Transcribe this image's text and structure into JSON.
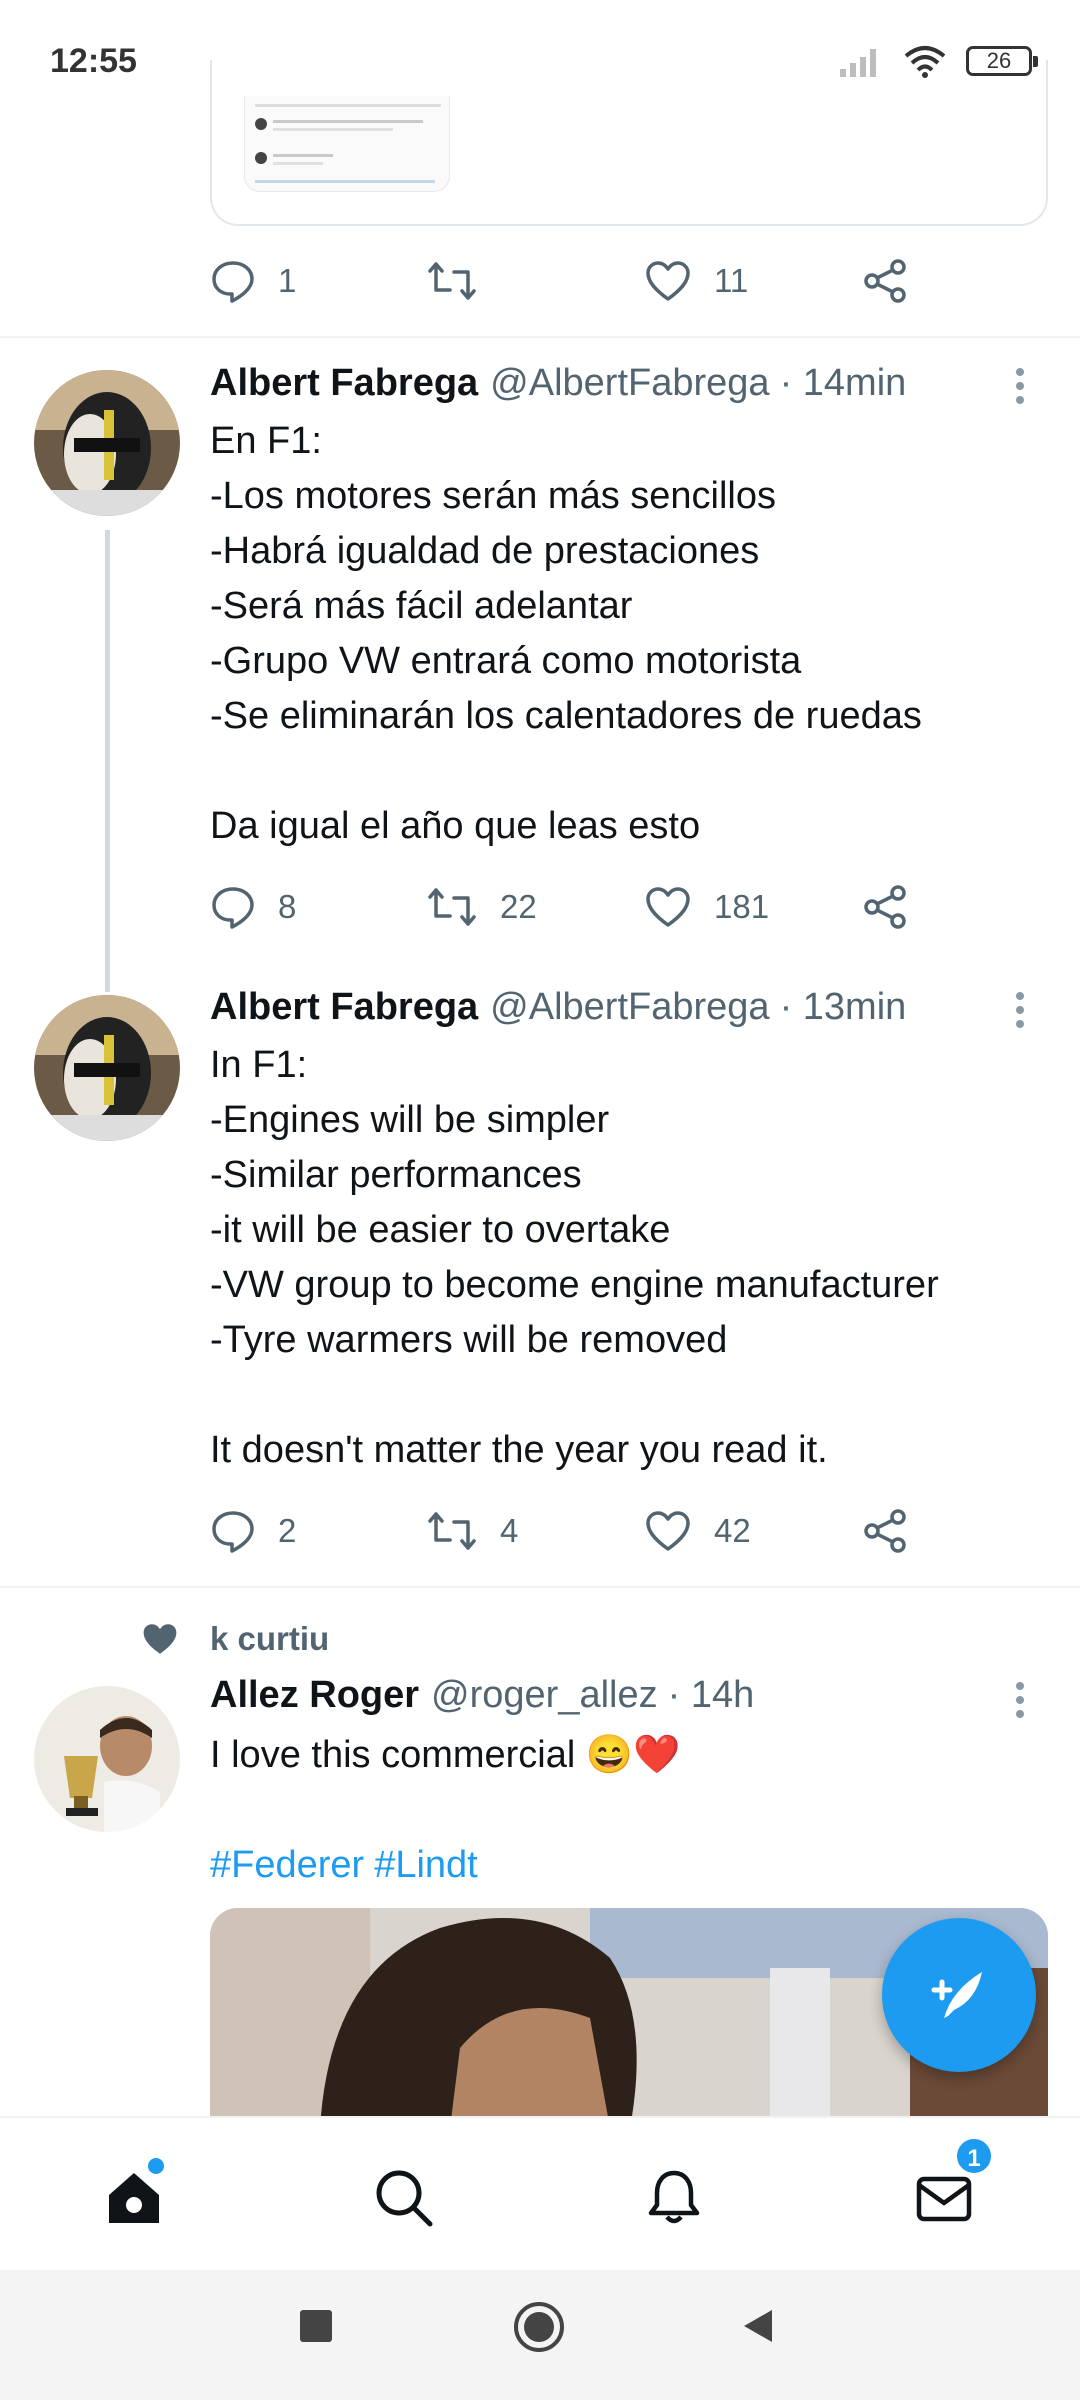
{
  "status_bar": {
    "time": "12:55",
    "battery": "26",
    "icons": [
      "signal-icon",
      "wifi-icon",
      "battery-icon"
    ]
  },
  "prev_tweet": {
    "replies": "1",
    "retweets": "",
    "likes": "11"
  },
  "tweets": [
    {
      "name": "Albert Fabrega",
      "handle": "@AlbertFabrega",
      "time": "· 14min",
      "lines": [
        "En F1:",
        "-Los motores serán más sencillos",
        "-Habrá igualdad de prestaciones",
        "-Será más fácil adelantar",
        "-Grupo VW entrará como motorista",
        "-Se eliminarán los calentadores de ruedas",
        "",
        "Da igual el año que leas esto"
      ],
      "replies": "8",
      "retweets": "22",
      "likes": "181"
    },
    {
      "name": "Albert Fabrega",
      "handle": "@AlbertFabrega",
      "time": "· 13min",
      "lines": [
        "In F1:",
        "-Engines will be simpler",
        "-Similar performances",
        "-it will be easier to overtake",
        "-VW group to become engine manufacturer",
        "-Tyre warmers will be removed",
        "",
        "It doesn't matter the year you read it."
      ],
      "replies": "2",
      "retweets": "4",
      "likes": "42"
    },
    {
      "social_context": "k curtiu",
      "name": "Allez Roger",
      "handle": "@roger_allez",
      "time": "· 14h",
      "text": "I love this commercial 😄❤️",
      "hashtags": [
        "#Federer",
        "#Lindt"
      ]
    }
  ],
  "bottom_nav": {
    "items": [
      "home-icon",
      "search-icon",
      "notifications-icon",
      "messages-icon"
    ],
    "messages_badge": "1"
  },
  "colors": {
    "accent": "#1d9bf0",
    "text_primary": "#0f1419",
    "text_secondary": "#536471",
    "divider": "#eff3f4"
  }
}
